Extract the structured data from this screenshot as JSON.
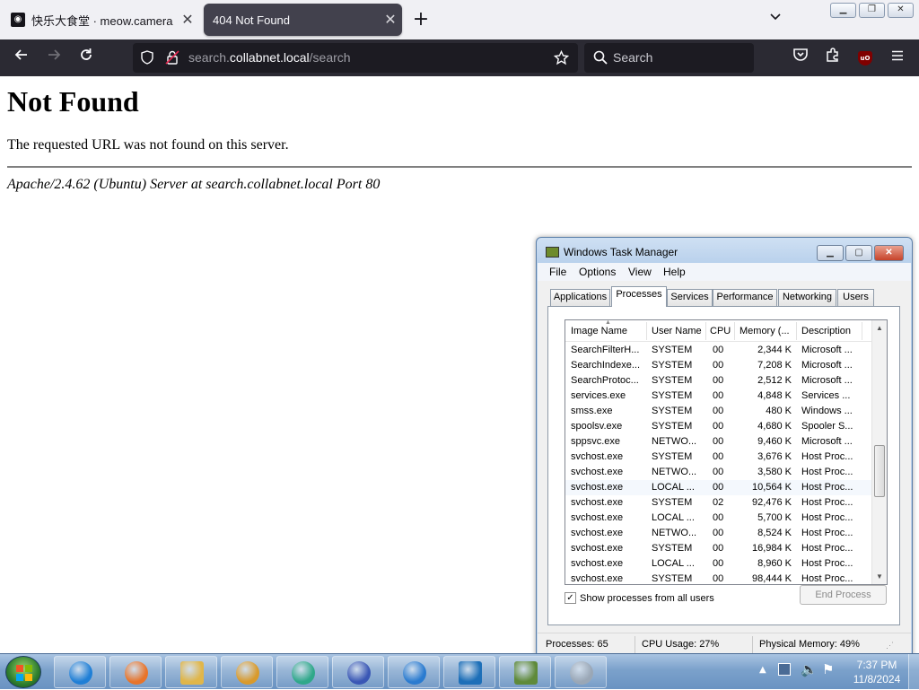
{
  "browser": {
    "tabs": [
      {
        "title": "快乐大食堂 · meow.camera",
        "favicon": "cat-icon",
        "active": false
      },
      {
        "title": "404 Not Found",
        "active": true
      }
    ],
    "url": {
      "prefix": "search.",
      "host": "collabnet.local",
      "path": "/search"
    },
    "search_placeholder": "Search",
    "extension_badge": "uO"
  },
  "page": {
    "heading": "Not Found",
    "message": "The requested URL was not found on this server.",
    "address": "Apache/2.4.62 (Ubuntu) Server at search.collabnet.local Port 80"
  },
  "task_manager": {
    "title": "Windows Task Manager",
    "menu": [
      "File",
      "Options",
      "View",
      "Help"
    ],
    "tabs": [
      "Applications",
      "Processes",
      "Services",
      "Performance",
      "Networking",
      "Users"
    ],
    "active_tab": "Processes",
    "columns": [
      "Image Name",
      "User Name",
      "CPU",
      "Memory (...",
      "Description"
    ],
    "processes": [
      {
        "name": "SearchFilterH...",
        "user": "SYSTEM",
        "cpu": "00",
        "mem": "2,344 K",
        "desc": "Microsoft ..."
      },
      {
        "name": "SearchIndexe...",
        "user": "SYSTEM",
        "cpu": "00",
        "mem": "7,208 K",
        "desc": "Microsoft ..."
      },
      {
        "name": "SearchProtoc...",
        "user": "SYSTEM",
        "cpu": "00",
        "mem": "2,512 K",
        "desc": "Microsoft ..."
      },
      {
        "name": "services.exe",
        "user": "SYSTEM",
        "cpu": "00",
        "mem": "4,848 K",
        "desc": "Services ..."
      },
      {
        "name": "smss.exe",
        "user": "SYSTEM",
        "cpu": "00",
        "mem": "480 K",
        "desc": "Windows ..."
      },
      {
        "name": "spoolsv.exe",
        "user": "SYSTEM",
        "cpu": "00",
        "mem": "4,680 K",
        "desc": "Spooler S..."
      },
      {
        "name": "sppsvc.exe",
        "user": "NETWO...",
        "cpu": "00",
        "mem": "9,460 K",
        "desc": "Microsoft ..."
      },
      {
        "name": "svchost.exe",
        "user": "SYSTEM",
        "cpu": "00",
        "mem": "3,676 K",
        "desc": "Host Proc..."
      },
      {
        "name": "svchost.exe",
        "user": "NETWO...",
        "cpu": "00",
        "mem": "3,580 K",
        "desc": "Host Proc..."
      },
      {
        "name": "svchost.exe",
        "user": "LOCAL ...",
        "cpu": "00",
        "mem": "10,564 K",
        "desc": "Host Proc..."
      },
      {
        "name": "svchost.exe",
        "user": "SYSTEM",
        "cpu": "02",
        "mem": "92,476 K",
        "desc": "Host Proc..."
      },
      {
        "name": "svchost.exe",
        "user": "LOCAL ...",
        "cpu": "00",
        "mem": "5,700 K",
        "desc": "Host Proc..."
      },
      {
        "name": "svchost.exe",
        "user": "NETWO...",
        "cpu": "00",
        "mem": "8,524 K",
        "desc": "Host Proc..."
      },
      {
        "name": "svchost.exe",
        "user": "SYSTEM",
        "cpu": "00",
        "mem": "16,984 K",
        "desc": "Host Proc..."
      },
      {
        "name": "svchost.exe",
        "user": "LOCAL ...",
        "cpu": "00",
        "mem": "8,960 K",
        "desc": "Host Proc..."
      },
      {
        "name": "svchost.exe",
        "user": "SYSTEM",
        "cpu": "00",
        "mem": "98,444 K",
        "desc": "Host Proc..."
      }
    ],
    "show_all_label": "Show processes from all users",
    "show_all_checked": true,
    "end_process_label": "End Process",
    "status": {
      "processes": "Processes: 65",
      "cpu": "CPU Usage: 27%",
      "memory": "Physical Memory: 49%"
    }
  },
  "taskbar": {
    "apps": [
      "internet-explorer-icon",
      "firefox-icon",
      "file-explorer-icon",
      "media-player-icon",
      "app-green-icon",
      "app-infinity-icon",
      "globe-icon",
      "virtualbox-icon",
      "task-manager-icon",
      "media-center-icon"
    ],
    "time": "7:37 PM",
    "date": "11/8/2024"
  }
}
